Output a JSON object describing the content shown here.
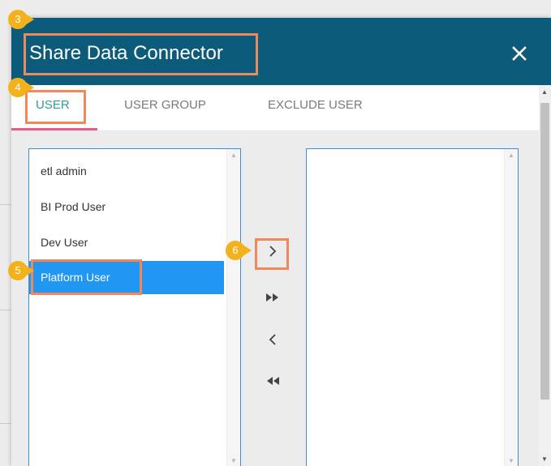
{
  "colors": {
    "header_bg": "#0d5b7a",
    "accent_teal": "#2e9c93",
    "tab_underline": "#e85a8a",
    "selection_bg": "#2196f3",
    "list_border": "#3a8fd6",
    "highlight": "#f0885a",
    "badge": "#f3b21b"
  },
  "dialog": {
    "title": "Share Data Connector",
    "close_icon": "close-icon"
  },
  "tabs": [
    {
      "label": "USER",
      "active": true
    },
    {
      "label": "USER GROUP",
      "active": false
    },
    {
      "label": "EXCLUDE USER",
      "active": false
    }
  ],
  "available_users": [
    {
      "label": "etl admin",
      "selected": false
    },
    {
      "label": "BI Prod User",
      "selected": false
    },
    {
      "label": "Dev User",
      "selected": false
    },
    {
      "label": "Platform User",
      "selected": true
    }
  ],
  "selected_users": [],
  "transfer_controls": [
    {
      "name": "move-selected-right-button",
      "icon": "chevron-right-icon"
    },
    {
      "name": "move-all-right-button",
      "icon": "double-play-right-icon"
    },
    {
      "name": "move-selected-left-button",
      "icon": "chevron-left-icon"
    },
    {
      "name": "move-all-left-button",
      "icon": "double-play-left-icon"
    }
  ],
  "annotations": {
    "step_title": "3",
    "step_tab": "4",
    "step_item": "5",
    "step_move": "6"
  }
}
